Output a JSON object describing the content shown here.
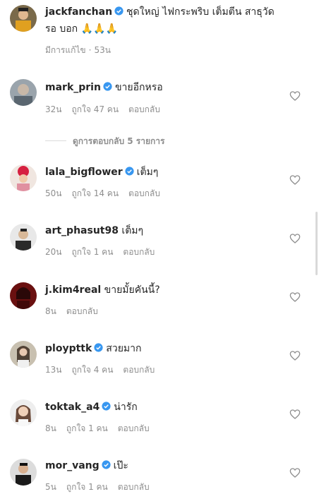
{
  "caption": {
    "username": "jackfanchan",
    "text_line1": "ชุดใหญ่ ไฟกระพริบ เต็มตีน สาธุวัด",
    "text_line2": "รอ บอก 🙏🙏🙏",
    "edited_label": "มีการแก้ไข",
    "separator": "·",
    "time": "53น"
  },
  "view_replies_label": "ดูการตอบกลับ 5 รายการ",
  "comments": [
    {
      "username": "mark_prin",
      "verified": true,
      "text": "ขายอีกหรอ",
      "time": "32น",
      "likes": "ถูกใจ 47 คน",
      "reply": "ตอบกลับ"
    },
    {
      "username": "lala_bigflower",
      "verified": true,
      "text": "เต็มๆ",
      "time": "50น",
      "likes": "ถูกใจ 14 คน",
      "reply": "ตอบกลับ"
    },
    {
      "username": "art_phasut98",
      "verified": false,
      "text": "เต็มๆ",
      "time": "20น",
      "likes": "ถูกใจ 1 คน",
      "reply": "ตอบกลับ"
    },
    {
      "username": "j.kim4real",
      "verified": false,
      "text": "ขายมั้ยคันนี้?",
      "time": "8น",
      "likes": "",
      "reply": "ตอบกลับ"
    },
    {
      "username": "ploypttk",
      "verified": true,
      "text": "สวยมาก",
      "time": "13น",
      "likes": "ถูกใจ 4 คน",
      "reply": "ตอบกลับ"
    },
    {
      "username": "toktak_a4",
      "verified": true,
      "text": "น่ารัก",
      "time": "8น",
      "likes": "ถูกใจ 1 คน",
      "reply": "ตอบกลับ"
    },
    {
      "username": "mor_vang",
      "verified": true,
      "text": "เป๊ะ",
      "time": "5น",
      "likes": "ถูกใจ 1 คน",
      "reply": "ตอบกลับ"
    }
  ],
  "colors": {
    "verified_blue": "#3897f0",
    "meta_gray": "#8e8e8e",
    "text": "#262626"
  }
}
